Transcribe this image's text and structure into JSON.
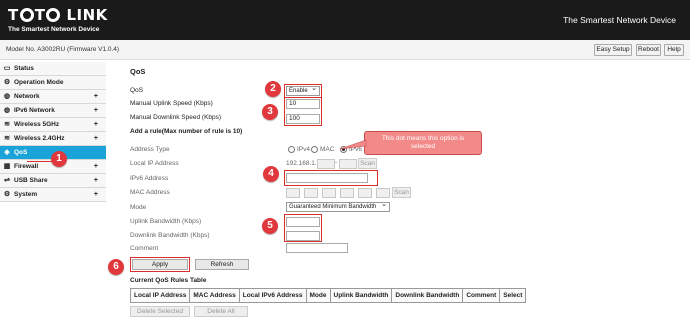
{
  "header": {
    "logo_part1": "T",
    "logo_part2": "T",
    "logo_part3": "LINK",
    "tagline": "The Smartest Network Device",
    "tagline_right": "The Smartest Network Device"
  },
  "modelbar": {
    "model": "Model No. A3002RU (Firmware V1.0.4)",
    "buttons": [
      "Easy Setup",
      "Reboot",
      "Help"
    ]
  },
  "sidebar": {
    "items": [
      {
        "label": "Status",
        "icon": "monitor-icon",
        "plus": ""
      },
      {
        "label": "Operation Mode",
        "icon": "gear-icon",
        "plus": ""
      },
      {
        "label": "Network",
        "icon": "globe-icon",
        "plus": "+"
      },
      {
        "label": "IPv6 Network",
        "icon": "globe-icon",
        "plus": "+"
      },
      {
        "label": "Wireless 5GHz",
        "icon": "wifi-icon",
        "plus": "+"
      },
      {
        "label": "Wireless 2.4GHz",
        "icon": "wifi-icon",
        "plus": "+"
      },
      {
        "label": "QoS",
        "icon": "qos-icon",
        "plus": ""
      },
      {
        "label": "Firewall",
        "icon": "firewall-icon",
        "plus": "+"
      },
      {
        "label": "USB Share",
        "icon": "usb-icon",
        "plus": "+"
      },
      {
        "label": "System",
        "icon": "gear-icon",
        "plus": "+"
      }
    ]
  },
  "main": {
    "title": "QoS",
    "qos_label": "QoS",
    "qos_value": "Enable",
    "uplink_label": "Manual Uplink Speed (Kbps)",
    "uplink_value": "10",
    "downlink_label": "Manual Downlink Speed (Kbps)",
    "downlink_value": "100",
    "add_rule_heading": "Add a rule(Max number of rule is 10)",
    "address_type_label": "Address Type",
    "address_types": [
      "IPv4",
      "MAC",
      "IPv6"
    ],
    "selected_address_type": "IPv6",
    "local_ip_label": "Local IP Address",
    "local_ip_prefix": "192.168.1.",
    "local_ip_sep": "-",
    "ipv6_label": "IPv6 Address",
    "mac_label": "MAC Address",
    "mode_label": "Mode",
    "mode_value": "Guaranteed Minimum Bandwidth",
    "uplink_bw_label": "Uplink Bandwidth (Kbps)",
    "downlink_bw_label": "Downlink Bandwidth (Kbps)",
    "comment_label": "Comment",
    "scan_label": "Scan",
    "apply_label": "Apply",
    "refresh_label": "Refresh",
    "table_title": "Current QoS Rules Table",
    "table_headers": [
      "Local IP Address",
      "MAC Address",
      "Local IPv6 Address",
      "Mode",
      "Uplink Bandwidth",
      "Downlink Bandwidth",
      "Comment",
      "Select"
    ],
    "delete_selected_label": "Delete Selected",
    "delete_all_label": "Delete All"
  },
  "annotations": {
    "badges": [
      "1",
      "2",
      "3",
      "4",
      "5",
      "6"
    ],
    "callout": "This dot means this option is selected",
    "color": "#e0383c"
  }
}
